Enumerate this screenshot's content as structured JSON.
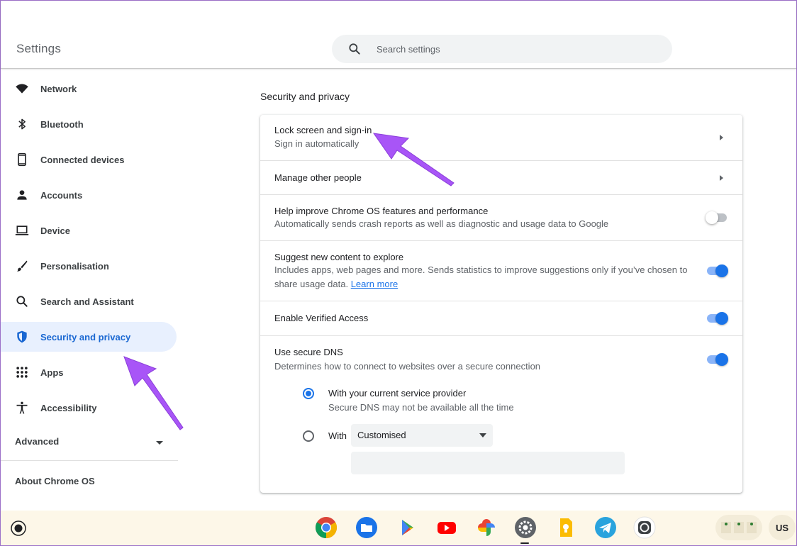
{
  "app": {
    "title": "Settings"
  },
  "search": {
    "placeholder": "Search settings"
  },
  "sidebar": {
    "items": [
      {
        "label": "Network",
        "icon": "wifi-icon"
      },
      {
        "label": "Bluetooth",
        "icon": "bluetooth-icon"
      },
      {
        "label": "Connected devices",
        "icon": "phone-icon"
      },
      {
        "label": "Accounts",
        "icon": "person-icon"
      },
      {
        "label": "Device",
        "icon": "laptop-icon"
      },
      {
        "label": "Personalisation",
        "icon": "brush-icon"
      },
      {
        "label": "Search and Assistant",
        "icon": "search-icon"
      },
      {
        "label": "Security and privacy",
        "icon": "shield-icon",
        "active": true
      },
      {
        "label": "Apps",
        "icon": "apps-grid-icon"
      },
      {
        "label": "Accessibility",
        "icon": "accessibility-icon"
      }
    ],
    "advanced_label": "Advanced",
    "about_label": "About Chrome OS"
  },
  "main": {
    "section_title": "Security and privacy",
    "rows": [
      {
        "title": "Lock screen and sign-in",
        "subtitle": "Sign in automatically",
        "control": "arrow"
      },
      {
        "title": "Manage other people",
        "control": "arrow"
      },
      {
        "title": "Help improve Chrome OS features and performance",
        "subtitle": "Automatically sends crash reports as well as diagnostic and usage data to Google",
        "control": "toggle",
        "on": false
      },
      {
        "title": "Suggest new content to explore",
        "subtitle": "Includes apps, web pages and more. Sends statistics to improve suggestions only if you’ve chosen to",
        "subtitle_line2": "share usage data.",
        "link": "Learn more",
        "control": "toggle",
        "on": true
      },
      {
        "title": "Enable Verified Access",
        "control": "toggle",
        "on": true
      },
      {
        "title": "Use secure DNS",
        "subtitle": "Determines how to connect to websites over a secure connection",
        "control": "toggle",
        "on": true
      }
    ],
    "dns": {
      "option1": {
        "label": "With your current service provider",
        "sublabel": "Secure DNS may not be available all the time",
        "checked": true
      },
      "option2": {
        "label": "With",
        "checked": false
      },
      "select_value": "Customised"
    }
  },
  "shelf": {
    "apps": [
      "chrome-icon",
      "files-icon",
      "play-store-icon",
      "youtube-icon",
      "photos-icon",
      "settings-icon",
      "keep-icon",
      "telegram-icon",
      "whatsapp-icon"
    ],
    "ime": "US"
  },
  "colors": {
    "accent": "#1a73e8",
    "active_bg": "#e8f0fe",
    "annotation": "#a855f7",
    "shelf_bg": "#fdf7e8"
  }
}
